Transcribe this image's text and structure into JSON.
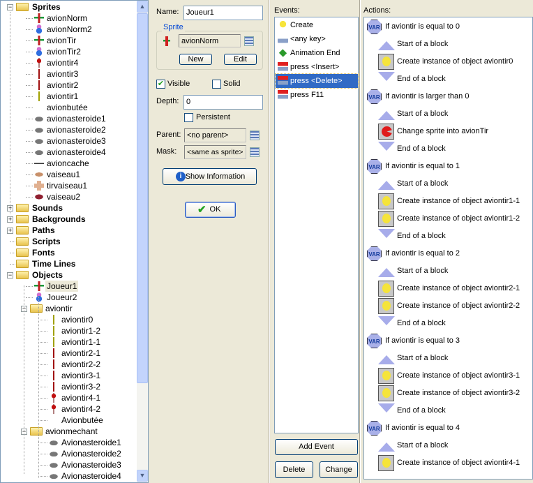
{
  "tree": [
    {
      "label": "Sprites",
      "level": 0,
      "kind": "folder",
      "expanded": true
    },
    {
      "label": "avionNorm",
      "level": 1,
      "icon": "plane-green"
    },
    {
      "label": "avionNorm2",
      "level": 1,
      "icon": "plane-blue"
    },
    {
      "label": "avionTir",
      "level": 1,
      "icon": "plane-green"
    },
    {
      "label": "avionTir2",
      "level": 1,
      "icon": "plane-blue"
    },
    {
      "label": "aviontir4",
      "level": 1,
      "icon": "bullet-red-big"
    },
    {
      "label": "aviontir3",
      "level": 1,
      "icon": "bullet-red"
    },
    {
      "label": "aviontir2",
      "level": 1,
      "icon": "bullet-red"
    },
    {
      "label": "aviontir1",
      "level": 1,
      "icon": "bullet-yellow"
    },
    {
      "label": "avionbutée",
      "level": 1,
      "icon": "none"
    },
    {
      "label": "avionasteroide1",
      "level": 1,
      "icon": "asteroid"
    },
    {
      "label": "avionasteroide2",
      "level": 1,
      "icon": "asteroid"
    },
    {
      "label": "avionasteroide3",
      "level": 1,
      "icon": "asteroid"
    },
    {
      "label": "avionasteroide4",
      "level": 1,
      "icon": "asteroid"
    },
    {
      "label": "avioncache",
      "level": 1,
      "icon": "line"
    },
    {
      "label": "vaiseau1",
      "level": 1,
      "icon": "ship"
    },
    {
      "label": "tirvaiseau1",
      "level": 1,
      "icon": "cross"
    },
    {
      "label": "vaiseau2",
      "level": 1,
      "icon": "ship-red"
    },
    {
      "label": "Sounds",
      "level": 0,
      "kind": "folder",
      "expanded": false
    },
    {
      "label": "Backgrounds",
      "level": 0,
      "kind": "folder",
      "expanded": false
    },
    {
      "label": "Paths",
      "level": 0,
      "kind": "folder",
      "expanded": false
    },
    {
      "label": "Scripts",
      "level": 0,
      "kind": "folder"
    },
    {
      "label": "Fonts",
      "level": 0,
      "kind": "folder"
    },
    {
      "label": "Time Lines",
      "level": 0,
      "kind": "folder"
    },
    {
      "label": "Objects",
      "level": 0,
      "kind": "folder",
      "expanded": true
    },
    {
      "label": "Joueur1",
      "level": 1,
      "icon": "plane-green",
      "selected": true
    },
    {
      "label": "Joueur2",
      "level": 1,
      "icon": "plane-blue"
    },
    {
      "label": "aviontir",
      "level": 1,
      "kind": "folder",
      "expanded": true
    },
    {
      "label": "aviontir0",
      "level": 2,
      "icon": "bullet-yellow"
    },
    {
      "label": "aviontir1-2",
      "level": 2,
      "icon": "bullet-yellow"
    },
    {
      "label": "aviontir1-1",
      "level": 2,
      "icon": "bullet-yellow"
    },
    {
      "label": "aviontir2-1",
      "level": 2,
      "icon": "bullet-red"
    },
    {
      "label": "aviontir2-2",
      "level": 2,
      "icon": "bullet-red"
    },
    {
      "label": "aviontir3-1",
      "level": 2,
      "icon": "bullet-red"
    },
    {
      "label": "aviontir3-2",
      "level": 2,
      "icon": "bullet-red"
    },
    {
      "label": "aviontir4-1",
      "level": 2,
      "icon": "bullet-red-big"
    },
    {
      "label": "aviontir4-2",
      "level": 2,
      "icon": "bullet-red-big"
    },
    {
      "label": "Avionbutée",
      "level": 2,
      "icon": "none"
    },
    {
      "label": "avionmechant",
      "level": 1,
      "kind": "folder",
      "expanded": true
    },
    {
      "label": "Avionasteroide1",
      "level": 2,
      "icon": "asteroid"
    },
    {
      "label": "Avionasteroide2",
      "level": 2,
      "icon": "asteroid"
    },
    {
      "label": "Avionasteroide3",
      "level": 2,
      "icon": "asteroid"
    },
    {
      "label": "Avionasteroide4",
      "level": 2,
      "icon": "asteroid"
    }
  ],
  "props": {
    "name_label": "Name:",
    "name_value": "Joueur1",
    "sprite_group": "Sprite",
    "sprite_value": "avionNorm",
    "new_label": "New",
    "edit_label": "Edit",
    "visible_label": "Visible",
    "visible_checked": true,
    "solid_label": "Solid",
    "solid_checked": false,
    "depth_label": "Depth:",
    "depth_value": "0",
    "persistent_label": "Persistent",
    "persistent_checked": false,
    "parent_label": "Parent:",
    "parent_value": "<no parent>",
    "mask_label": "Mask:",
    "mask_value": "<same as sprite>",
    "show_info_label": "Show Information",
    "ok_label": "OK"
  },
  "events": {
    "label": "Events:",
    "items": [
      {
        "label": "Create",
        "icon": "lightbulb"
      },
      {
        "label": "<any key>",
        "icon": "keyboard"
      },
      {
        "label": "Animation End",
        "icon": "green-diamond"
      },
      {
        "label": "press <Insert>",
        "icon": "key-press"
      },
      {
        "label": "press <Delete>",
        "icon": "key-press",
        "selected": true
      },
      {
        "label": "press F11",
        "icon": "key-press"
      }
    ],
    "add_label": "Add Event",
    "delete_label": "Delete",
    "change_label": "Change"
  },
  "actions": {
    "label": "Actions:",
    "items": [
      {
        "type": "var",
        "label": "If aviontir is equal to 0"
      },
      {
        "type": "start",
        "label": "Start of a block"
      },
      {
        "type": "bulb",
        "label": "Create instance of object aviontir0"
      },
      {
        "type": "end",
        "label": "End of a block"
      },
      {
        "type": "var",
        "label": "If aviontir is larger than 0"
      },
      {
        "type": "start",
        "label": "Start of a block"
      },
      {
        "type": "pacman",
        "label": "Change sprite into avionTir"
      },
      {
        "type": "end",
        "label": "End of a block"
      },
      {
        "type": "var",
        "label": "If aviontir is equal to 1"
      },
      {
        "type": "start",
        "label": "Start of a block"
      },
      {
        "type": "bulb",
        "label": "Create instance of object aviontir1-1"
      },
      {
        "type": "bulb",
        "label": "Create instance of object aviontir1-2"
      },
      {
        "type": "end",
        "label": "End of a block"
      },
      {
        "type": "var",
        "label": "If aviontir is equal to 2"
      },
      {
        "type": "start",
        "label": "Start of a block"
      },
      {
        "type": "bulb",
        "label": "Create instance of object aviontir2-1"
      },
      {
        "type": "bulb",
        "label": "Create instance of object aviontir2-2"
      },
      {
        "type": "end",
        "label": "End of a block"
      },
      {
        "type": "var",
        "label": "If aviontir is equal to 3"
      },
      {
        "type": "start",
        "label": "Start of a block"
      },
      {
        "type": "bulb",
        "label": "Create instance of object aviontir3-1"
      },
      {
        "type": "bulb",
        "label": "Create instance of object aviontir3-2"
      },
      {
        "type": "end",
        "label": "End of a block"
      },
      {
        "type": "var",
        "label": "If aviontir is equal to 4"
      },
      {
        "type": "start",
        "label": "Start of a block"
      },
      {
        "type": "bulb",
        "label": "Create instance of object aviontir4-1"
      }
    ]
  },
  "colors": {
    "selection": "#316ac5",
    "panel": "#ece9d8",
    "border": "#7f9db9",
    "group_title": "#0046d5"
  }
}
